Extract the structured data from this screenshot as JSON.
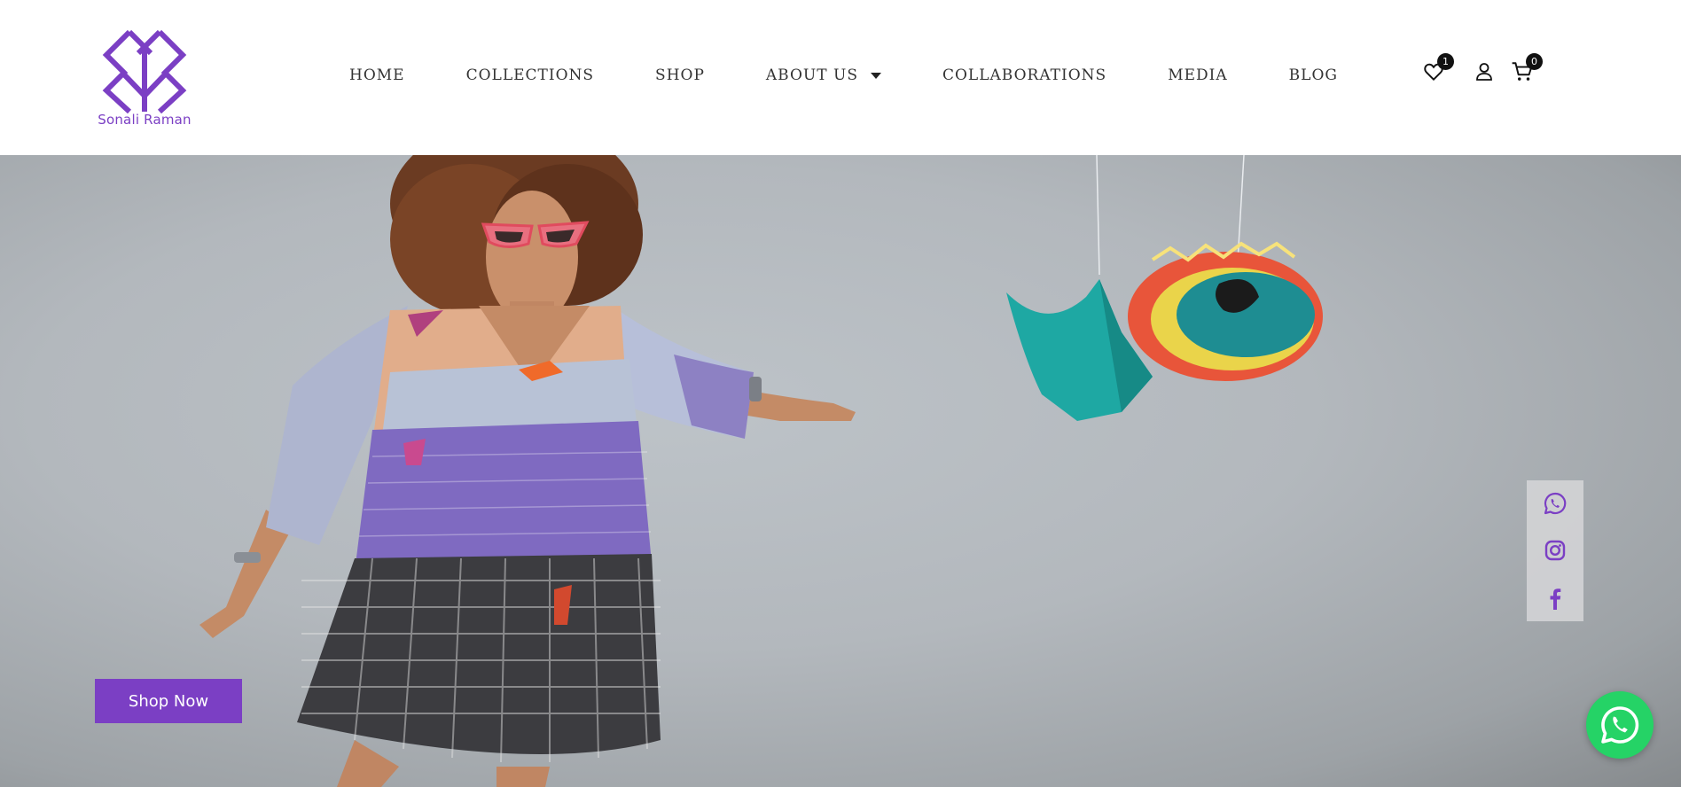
{
  "brand": {
    "name": "Sonali Raman",
    "color": "#7b3fc4"
  },
  "nav": {
    "items": [
      {
        "label": "HOME"
      },
      {
        "label": "COLLECTIONS"
      },
      {
        "label": "SHOP"
      },
      {
        "label": "ABOUT US"
      },
      {
        "label": "COLLABORATIONS"
      },
      {
        "label": "MEDIA"
      },
      {
        "label": "BLOG"
      }
    ]
  },
  "header_icons": {
    "wishlist": {
      "icon": "heart-icon",
      "count": "1"
    },
    "account": {
      "icon": "user-icon"
    },
    "cart": {
      "icon": "cart-icon",
      "count": "0"
    }
  },
  "hero": {
    "cta_label": "Shop Now"
  },
  "social": {
    "items": [
      {
        "icon": "whatsapp-icon"
      },
      {
        "icon": "instagram-icon"
      },
      {
        "icon": "facebook-icon"
      }
    ]
  },
  "floating": {
    "icon": "whatsapp-icon",
    "color": "#25d366"
  }
}
